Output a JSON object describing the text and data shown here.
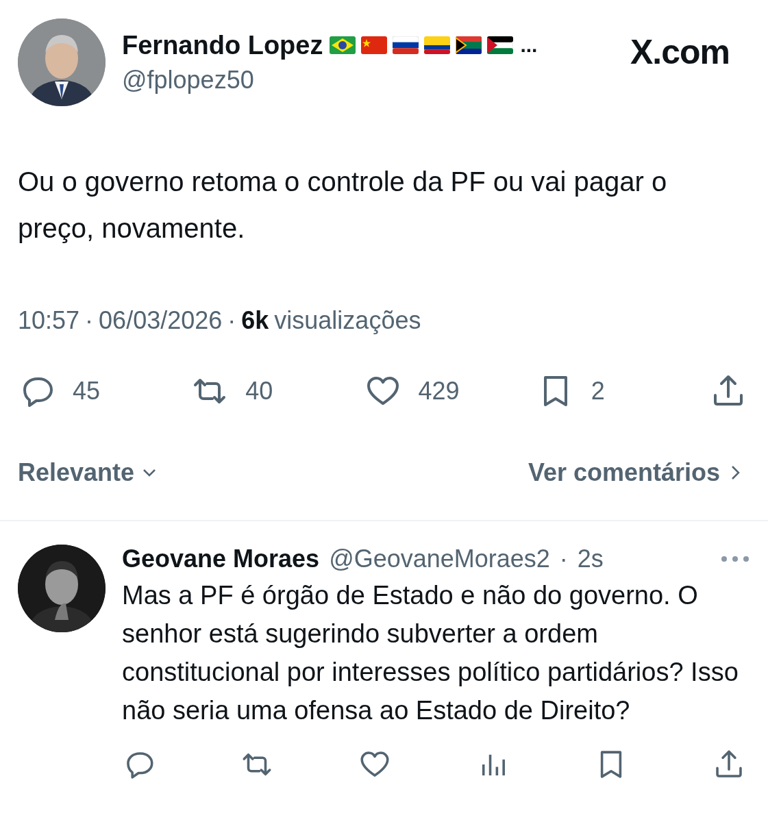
{
  "post": {
    "author": {
      "name": "Fernando Lopez",
      "name_overflow": "...",
      "handle": "@fplopez50"
    },
    "site_logo": "X.com",
    "text": "Ou o governo retoma o controle da PF ou vai pagar o preço, novamente.",
    "meta": {
      "time": "10:57",
      "date": "06/03/2026",
      "views_count": "6k",
      "views_label": "visualizações",
      "separator": "·"
    },
    "actions": [
      {
        "kind": "reply",
        "count": "45"
      },
      {
        "kind": "repost",
        "count": "40"
      },
      {
        "kind": "like",
        "count": "429"
      },
      {
        "kind": "bookmark",
        "count": "2"
      },
      {
        "kind": "share"
      }
    ]
  },
  "sort": {
    "label": "Relevante"
  },
  "view_comments": {
    "label": "Ver comentários"
  },
  "reply": {
    "author": {
      "name": "Geovane Moraes",
      "handle": "@GeovaneMoraes2",
      "separator": "·",
      "age": "2s"
    },
    "text": "Mas a PF é órgão de Estado e não do governo. O senhor está sugerindo subverter a ordem constitucional por interesses político partidários? Isso não seria uma ofensa ao Estado de Direito?",
    "actions": [
      {
        "kind": "reply"
      },
      {
        "kind": "repost"
      },
      {
        "kind": "like"
      },
      {
        "kind": "views"
      },
      {
        "kind": "bookmark"
      },
      {
        "kind": "share"
      }
    ]
  }
}
